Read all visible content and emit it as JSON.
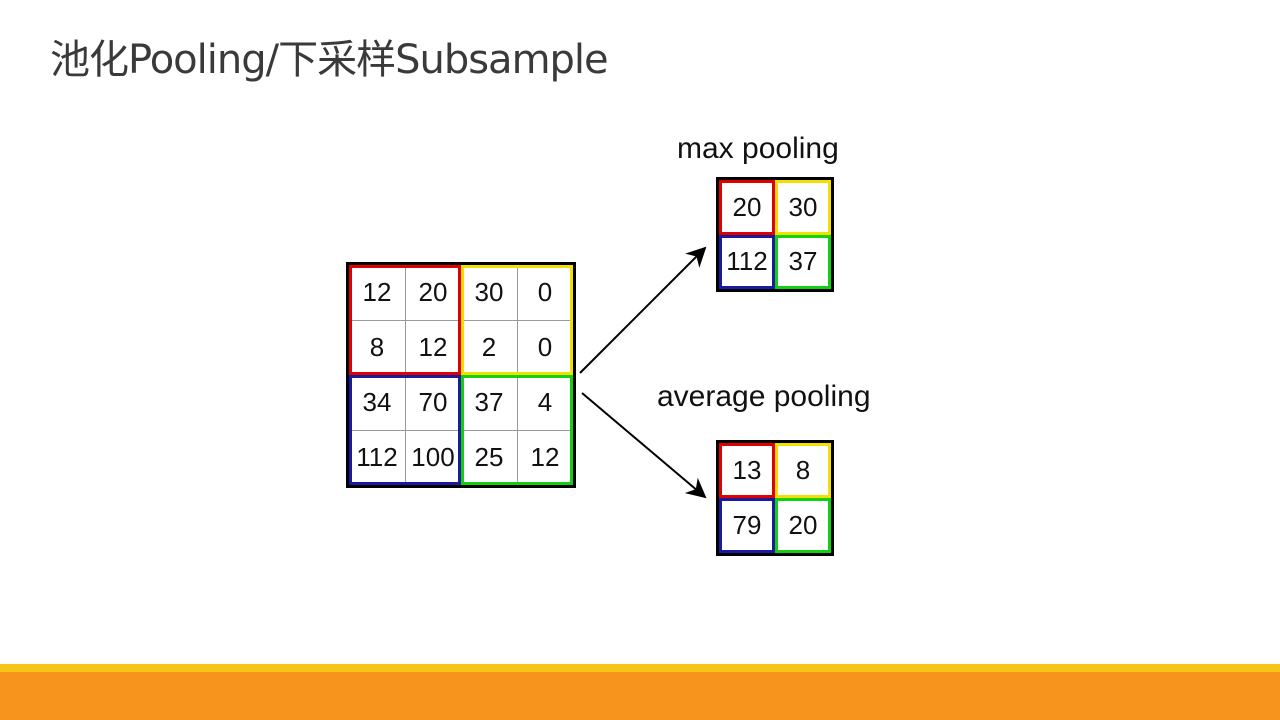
{
  "slide": {
    "title": "池化Pooling/下采样Subsample"
  },
  "colors": {
    "footer_yellow": "#f5c518",
    "footer_orange": "#f7941d",
    "q_red": "#e00000",
    "q_yellow": "#f2e000",
    "q_blue": "#1a1aa0",
    "q_green": "#10d010"
  },
  "input_matrix": {
    "cells": [
      [
        "12",
        "20",
        "30",
        "0"
      ],
      [
        "8",
        "12",
        "2",
        "0"
      ],
      [
        "34",
        "70",
        "37",
        "4"
      ],
      [
        "112",
        "100",
        "25",
        "12"
      ]
    ]
  },
  "max_pooling": {
    "label": "max pooling",
    "cells": [
      [
        "20",
        "30"
      ],
      [
        "112",
        "37"
      ]
    ]
  },
  "average_pooling": {
    "label": "average pooling",
    "cells": [
      [
        "13",
        "8"
      ],
      [
        "79",
        "20"
      ]
    ]
  }
}
